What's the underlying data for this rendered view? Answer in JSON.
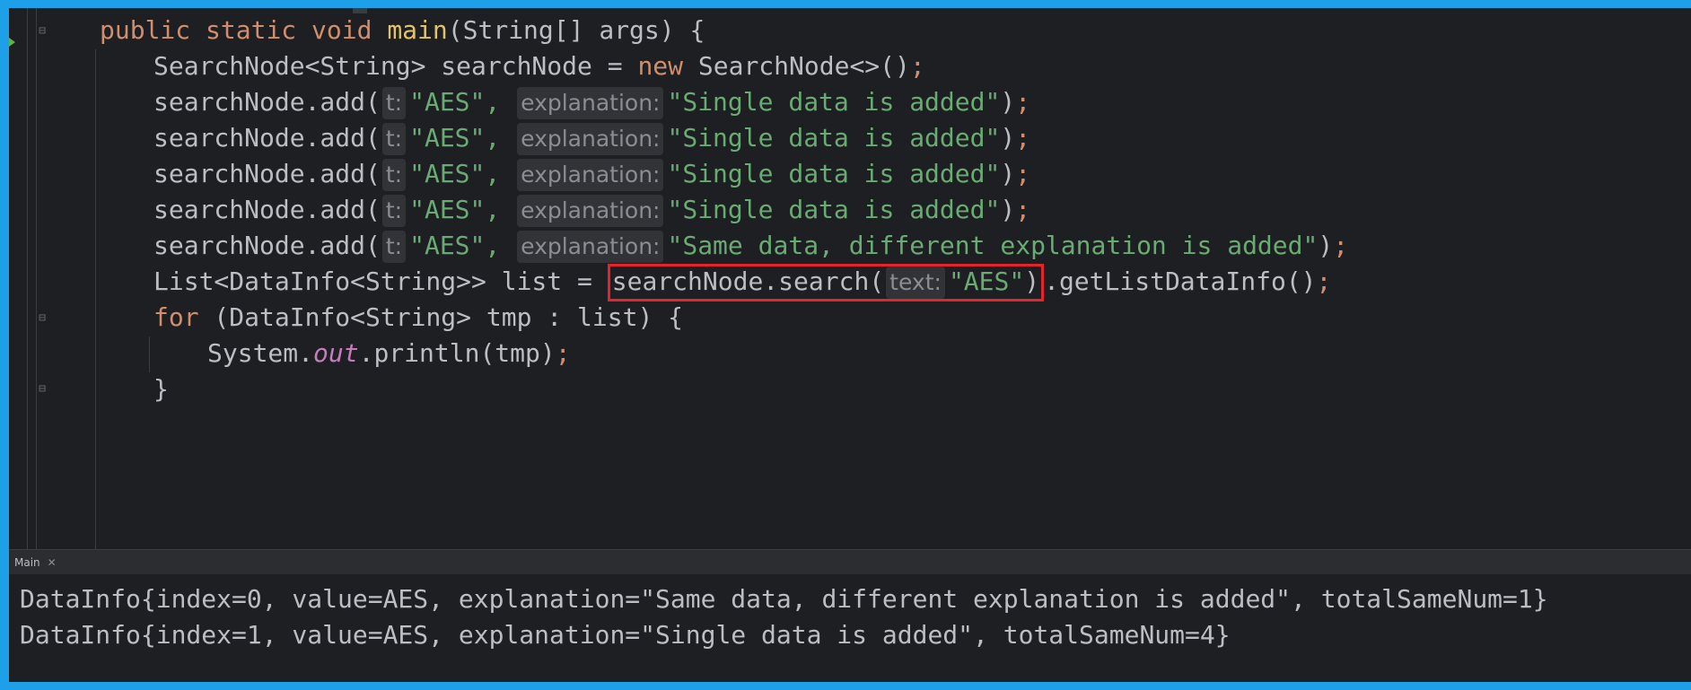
{
  "code": {
    "line1": {
      "kw_public": "public",
      "kw_static": "static",
      "kw_void": "void",
      "method": "main",
      "rest": "(String[] args) {"
    },
    "line2": {
      "decl": "SearchNode<String> searchNode = ",
      "kw_new": "new",
      "ctor": " SearchNode<>()",
      "semi": ";"
    },
    "add_calls": [
      {
        "prefix": "searchNode.add(",
        "hint_t": "t:",
        "arg1": "\"AES\",",
        "hint_expl": "explanation:",
        "arg2": "\"Single data is added\"",
        "close": ")",
        "semi": ";"
      },
      {
        "prefix": "searchNode.add(",
        "hint_t": "t:",
        "arg1": "\"AES\",",
        "hint_expl": "explanation:",
        "arg2": "\"Single data is added\"",
        "close": ")",
        "semi": ";"
      },
      {
        "prefix": "searchNode.add(",
        "hint_t": "t:",
        "arg1": "\"AES\",",
        "hint_expl": "explanation:",
        "arg2": "\"Single data is added\"",
        "close": ")",
        "semi": ";"
      },
      {
        "prefix": "searchNode.add(",
        "hint_t": "t:",
        "arg1": "\"AES\",",
        "hint_expl": "explanation:",
        "arg2": "\"Single data is added\"",
        "close": ")",
        "semi": ";"
      },
      {
        "prefix": "searchNode.add(",
        "hint_t": "t:",
        "arg1": "\"AES\",",
        "hint_expl": "explanation:",
        "arg2": "\"Same data, different explanation is added\"",
        "close": ")",
        "semi": ";"
      }
    ],
    "line8": {
      "decl": "List<DataInfo<String>> list = ",
      "search_call": "searchNode.search(",
      "hint_text": "text:",
      "search_arg": "\"AES\"",
      "search_close": ")",
      "rest": ".getListDataInfo()",
      "semi": ";"
    },
    "line9": {
      "kw_for": "for",
      "rest": " (DataInfo<String> tmp : list) {"
    },
    "line10": {
      "system": "System.",
      "field": "out",
      "rest": ".println(tmp)",
      "semi": ";"
    },
    "line11": {
      "brace": "}"
    }
  },
  "console": {
    "tab_label": "Main",
    "lines": [
      "DataInfo{index=0, value=AES, explanation=\"Same data, different explanation is added\", totalSameNum=1}",
      "DataInfo{index=1, value=AES, explanation=\"Single data is added\", totalSameNum=4}"
    ]
  },
  "colors": {
    "keyword": "#cf8e6d",
    "string": "#6aab73",
    "method_decl": "#e0c46c",
    "field": "#c77dbb",
    "highlight_border": "#e3242b",
    "window_border": "#1ea0e8"
  }
}
